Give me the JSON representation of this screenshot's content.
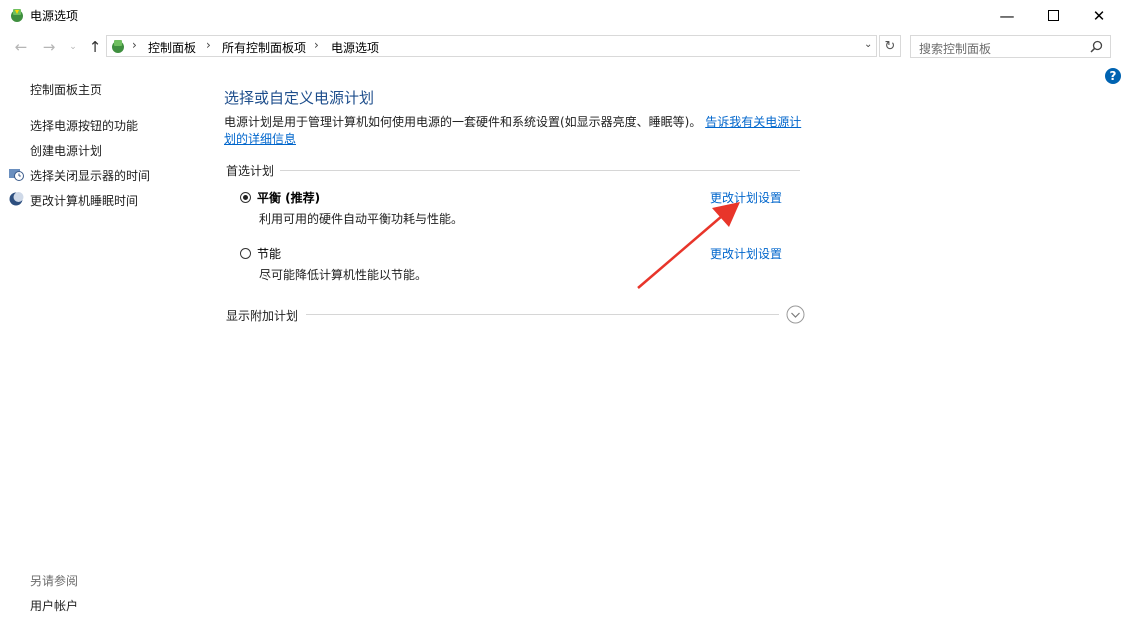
{
  "window": {
    "title": "电源选项",
    "controls": [
      "minimize",
      "maximize",
      "close"
    ]
  },
  "address": {
    "breadcrumbs": [
      "控制面板",
      "所有控制面板项",
      "电源选项"
    ],
    "search_placeholder": "搜索控制面板"
  },
  "sidebar": {
    "home": "控制面板主页",
    "links": [
      "选择电源按钮的功能",
      "创建电源计划",
      "选择关闭显示器的时间",
      "更改计算机睡眠时间"
    ],
    "see_also_title": "另请参阅",
    "see_also_links": [
      "用户帐户"
    ]
  },
  "main": {
    "title": "选择或自定义电源计划",
    "description": "电源计划是用于管理计算机如何使用电源的一套硬件和系统设置(如显示器亮度、睡眠等)。",
    "description_link": "告诉我有关电源计划的详细信息",
    "preferred_group_label": "首选计划",
    "plans": [
      {
        "name": "平衡 (推荐)",
        "desc": "利用可用的硬件自动平衡功耗与性能。",
        "selected": true,
        "link": "更改计划设置"
      },
      {
        "name": "节能",
        "desc": "尽可能降低计算机性能以节能。",
        "selected": false,
        "link": "更改计划设置"
      }
    ],
    "additional_plans_label": "显示附加计划"
  },
  "colors": {
    "link": "#0066cc",
    "title": "#1e4e8c",
    "annotation_arrow": "#e8352a"
  }
}
